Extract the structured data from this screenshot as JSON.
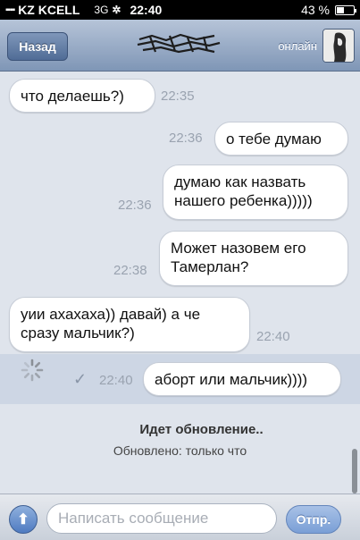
{
  "status_bar": {
    "signal": "▪▪▪▪",
    "carrier": "KZ KCELL",
    "network": "3G",
    "activity": "✲",
    "time": "22:40",
    "battery_percent": "43 %",
    "battery_level": 0.43
  },
  "nav": {
    "back_label": "Назад",
    "presence": "онлайн"
  },
  "messages": [
    {
      "text": "что делаешь?)",
      "time": "22:35",
      "side": "incoming"
    },
    {
      "text": "о тебе думаю",
      "time": "22:36",
      "side": "outgoing"
    },
    {
      "text": "думаю как назвать нашего ребенка)))))",
      "time": "22:36",
      "side": "outgoing"
    },
    {
      "text": "Может назовем его Тамерлан?",
      "time": "22:38",
      "side": "outgoing"
    },
    {
      "text": "уии ахахаха)) давай) а че сразу мальчик?)",
      "time": "22:40",
      "side": "incoming"
    },
    {
      "text": "аборт или мальчик))))",
      "time": "22:40",
      "side": "outgoing"
    }
  ],
  "update": {
    "title": "Идет обновление..",
    "subtitle": "Обновлено: только что"
  },
  "input": {
    "placeholder": "Написать сообщение",
    "send_label": "Отпр."
  },
  "colors": {
    "background": "#dfe4ec",
    "nav_top": "#b6c4d8",
    "nav_bottom": "#7f96b6",
    "bubble": "#ffffff",
    "send": "#7a9fd6"
  }
}
